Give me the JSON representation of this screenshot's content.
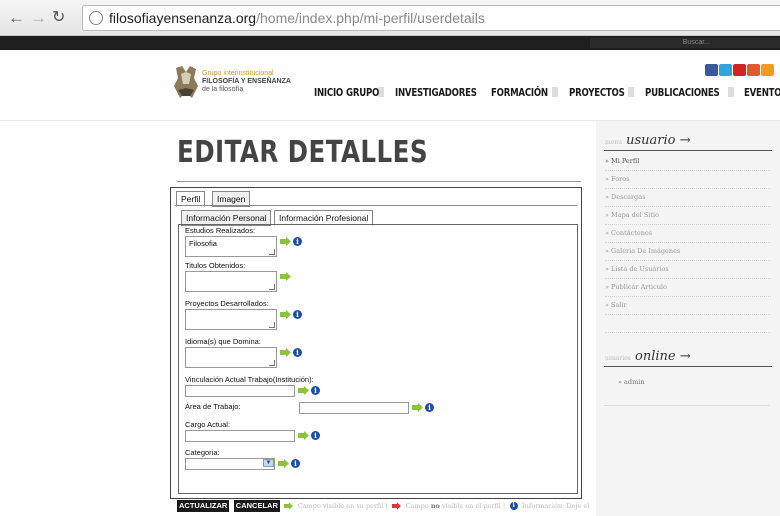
{
  "browser": {
    "url_domain": "filosofiayensenanza.org",
    "url_path": "/home/index.php/mi-perfil/userdetails"
  },
  "topbar": {
    "search_placeholder": "Buscar..."
  },
  "logo": {
    "line1": "Grupo interinstitucional",
    "line2": "FILOSOFÍA Y ENSEÑANZA",
    "line3": "de la filosofía"
  },
  "nav": [
    "INICIO",
    "GRUPO",
    "INVESTIGADORES",
    "FORMACIÓN",
    "PROYECTOS",
    "PUBLICACIONES",
    "EVENTOS"
  ],
  "page": {
    "title": "EDITAR DETALLES"
  },
  "form": {
    "tabs": [
      "Perfil",
      "Imagen"
    ],
    "subtabs": [
      "Información Personal",
      "Información Profesional"
    ],
    "fields": {
      "estudios": {
        "label": "Estudios Realizados:",
        "value": "Filosofia"
      },
      "titulos": {
        "label": "Titulos Obtenidos:",
        "value": ""
      },
      "proyectos": {
        "label": "Proyectos Desarrollados:",
        "value": ""
      },
      "idiomas": {
        "label": "Idioma(s) que Domina:",
        "value": ""
      },
      "vinculacion": {
        "label": "Vinculación Actual Trabajo(Institución):",
        "value": ""
      },
      "area": {
        "label": "Área de Trabajo:",
        "value": ""
      },
      "cargo": {
        "label": "Cargo Actual:",
        "value": ""
      },
      "categoria": {
        "label": "Categoria:",
        "value": ""
      }
    },
    "info_icon": "i"
  },
  "actions": {
    "update_label": "ACTUALIZAR",
    "cancel_label": "CANCELAR",
    "legend_visible": "Campo visible en su perfil |",
    "legend_not_prefix": "Campo",
    "legend_not_bold": "no",
    "legend_not_suffix": "visible en el perfil |",
    "legend_info": "Información: Deje el"
  },
  "sidebar": {
    "menu_small": "menu",
    "menu_title": "usuario",
    "arrow": "→",
    "links": [
      "» Mi Perfil",
      "» Foros",
      "» Descargas",
      "» Mapa del Sitio",
      "» Contáctenos",
      "» Galeria De Imágenes",
      "» Lista de Usuarios",
      "» Publicar Articulo",
      "» Salir"
    ],
    "online_small": "usuarios",
    "online_title": "online",
    "online_user": "» admin"
  },
  "colors": {
    "topbar": "#1e1e1e",
    "facebook": "#3b5998",
    "twitter": "#33a3dc",
    "youtube": "#d32323",
    "delicious": "#e05a2b",
    "rss": "#f39b1f",
    "info_blue": "#1a4ea8",
    "visible_green": "#8ac43c"
  },
  "icons": [
    "back-arrow-icon",
    "forward-arrow-icon",
    "reload-icon",
    "globe-icon",
    "facebook-icon",
    "twitter-icon",
    "youtube-icon",
    "delicious-icon",
    "rss-icon",
    "visible-field-icon",
    "info-icon",
    "dropdown-arrow-icon"
  ]
}
